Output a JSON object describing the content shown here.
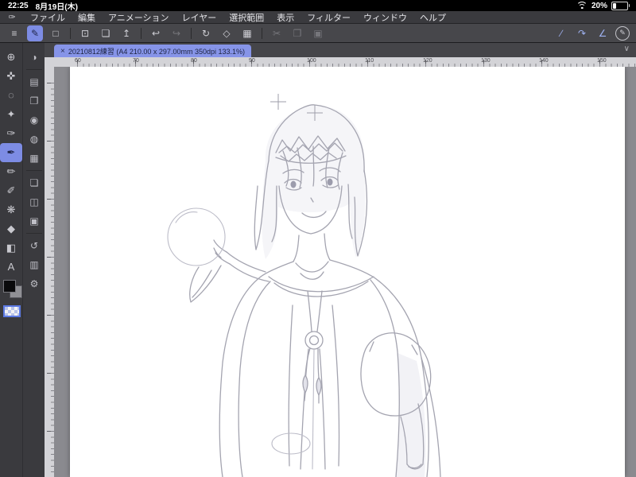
{
  "status": {
    "time": "22:25",
    "date": "8月19日(木)",
    "battery": "20%"
  },
  "menu": {
    "logo_glyph": "✑",
    "items": [
      "ファイル",
      "編集",
      "アニメーション",
      "レイヤー",
      "選択範囲",
      "表示",
      "フィルター",
      "ウィンドウ",
      "ヘルプ"
    ]
  },
  "toolbar": {
    "icons": [
      {
        "name": "main-menu",
        "glyph": "≡"
      },
      {
        "name": "operation-select",
        "glyph": "✎",
        "state": "active"
      },
      {
        "name": "transform",
        "glyph": "□"
      },
      {
        "name": "export-device",
        "glyph": "⊡"
      },
      {
        "name": "open-file",
        "glyph": "❏"
      },
      {
        "name": "share-file",
        "glyph": "↥"
      },
      {
        "name": "undo",
        "glyph": "↩"
      },
      {
        "name": "redo",
        "glyph": "↪",
        "state": "disabled"
      },
      {
        "name": "rotate-view",
        "glyph": "↻"
      },
      {
        "name": "clear-canvas",
        "glyph": "◇"
      },
      {
        "name": "trim-canvas",
        "glyph": "▦"
      },
      {
        "name": "cut",
        "glyph": "✂",
        "state": "disabled"
      },
      {
        "name": "copy",
        "glyph": "❐",
        "state": "disabled"
      },
      {
        "name": "paste",
        "glyph": "▣",
        "state": "disabled"
      },
      {
        "name": "snap-to-ruler",
        "glyph": "∕",
        "state": "snap-on"
      },
      {
        "name": "snap-to-special-ruler",
        "glyph": "↷",
        "state": "snap-on"
      },
      {
        "name": "snap-to-grid",
        "glyph": "∠",
        "state": "snap-on"
      },
      {
        "name": "assistant-pen",
        "glyph": "✎"
      }
    ]
  },
  "tabbar": {
    "close": "×",
    "title": "20210812練習 (A4 210.00 x 297.00mm 350dpi 133.1%)",
    "chevron": "∨"
  },
  "ruler": {
    "top_numbers": [
      "60",
      "70",
      "80",
      "90",
      "100",
      "110",
      "120",
      "130",
      "140",
      "150"
    ]
  },
  "tools": {
    "items": [
      {
        "name": "zoom-tool",
        "glyph": "⊕"
      },
      {
        "name": "move-tool",
        "glyph": "✜"
      },
      {
        "name": "selection-tool",
        "glyph": "◌"
      },
      {
        "name": "auto-select-tool",
        "glyph": "✦"
      },
      {
        "name": "eyedropper-tool",
        "glyph": "✑"
      },
      {
        "name": "pen-tool",
        "glyph": "✒",
        "state": "active"
      },
      {
        "name": "pencil-tool",
        "glyph": "✏"
      },
      {
        "name": "brush-tool",
        "glyph": "✐"
      },
      {
        "name": "airbrush-tool",
        "glyph": "❋"
      },
      {
        "name": "eraser-tool",
        "glyph": "◆"
      },
      {
        "name": "fill-tool",
        "glyph": "◧"
      },
      {
        "name": "text-tool",
        "glyph": "A"
      }
    ]
  },
  "panels": {
    "icons": [
      {
        "name": "color-indicator",
        "glyph": "◑"
      },
      {
        "name": "quick-access-panel",
        "glyph": "▤"
      },
      {
        "name": "sub-tool-panel",
        "glyph": "❐"
      },
      {
        "name": "brush-size-panel",
        "glyph": "◉"
      },
      {
        "name": "color-wheel-panel",
        "glyph": "◍"
      },
      {
        "name": "color-set-panel",
        "glyph": "▦"
      },
      {
        "name": "layer-panel",
        "glyph": "❏"
      },
      {
        "name": "layer-property-panel",
        "glyph": "◫"
      },
      {
        "name": "navigator-panel",
        "glyph": "▣"
      },
      {
        "name": "history-panel",
        "glyph": "↺"
      },
      {
        "name": "material-panel",
        "glyph": "▥"
      },
      {
        "name": "settings-panel",
        "glyph": "⚙"
      }
    ]
  },
  "colors": {
    "accent_blue": "#7d8ce4",
    "tab_blue": "#8694e8",
    "selection_border_blue": "#5b79e3",
    "toolbar_bg": "#47474b",
    "sidebar_bg": "#3a3a3e",
    "canvas_surround": "#8a8a8f",
    "main_color": "#0a0a0c",
    "sub_color": "#909095"
  }
}
